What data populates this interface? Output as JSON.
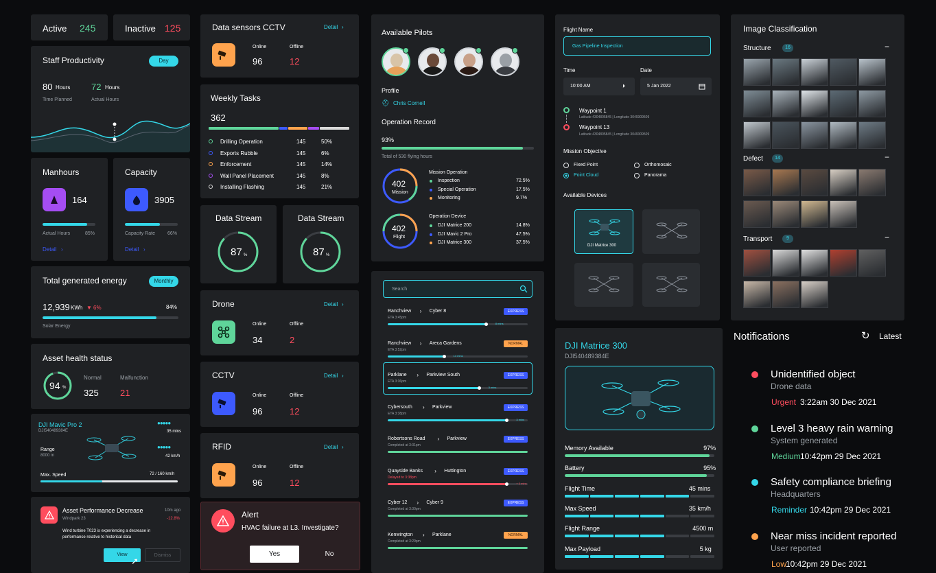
{
  "active": {
    "label": "Active",
    "value": "245"
  },
  "inactive": {
    "label": "Inactive",
    "value": "125"
  },
  "productivity": {
    "title": "Staff Productivity",
    "pill": "Day",
    "planned_value": "80",
    "planned_unit": "Hours",
    "planned_label": "Time Planned",
    "actual_value": "72",
    "actual_unit": "Hours",
    "actual_label": "Actual Hours"
  },
  "manhours": {
    "title": "Manhours",
    "value": "164",
    "bar_label": "Actual Hours",
    "pct": "85%",
    "fill": 0.85,
    "detail": "Detail"
  },
  "capacity": {
    "title": "Capacity",
    "value": "3905",
    "bar_label": "Capacity Rate",
    "pct": "66%",
    "fill": 0.66,
    "detail": "Detail"
  },
  "energy": {
    "title": "Total generated energy",
    "pill": "Monthly",
    "value": "12,939",
    "unit": "KWh",
    "change": "6%",
    "pct": "84%",
    "fill": 0.84,
    "label": "Solar Energy"
  },
  "asset_health": {
    "title": "Asset health status",
    "percent": "94",
    "percent_sign": "%",
    "normal_label": "Normal",
    "normal_value": "325",
    "malfunction_label": "Malfunction",
    "malfunction_value": "21",
    "fill": 0.94
  },
  "mavic": {
    "name": "DJI Mavic Pro 2",
    "id": "DJI540489384E",
    "time": "35 mins",
    "range_label": "Range",
    "range_value": "8000 m",
    "speed": "42 km/h",
    "max_speed_label": "Max. Speed",
    "max_speed_value": "72 / 160 km/h",
    "fill": 0.45
  },
  "asset_alert": {
    "title": "Asset Performance Decrease",
    "time": "10m ago",
    "location": "Windpark 23",
    "change": "-12.8%",
    "body1": "Wind turbine T023 is experiencing a decrease in",
    "body2": "performance relative to historical data",
    "view": "View",
    "dismiss": "Dismiss"
  },
  "cctv_sensors": {
    "title": "Data sensors CCTV",
    "detail": "Detail",
    "online_label": "Online",
    "online": "96",
    "offline_label": "Offline",
    "offline": "12"
  },
  "weekly": {
    "title": "Weekly Tasks",
    "total": "362",
    "items": [
      {
        "name": "Drilling Operation",
        "count": "145",
        "pct": "50%",
        "color": "#5fd59a"
      },
      {
        "name": "Exports Rubble",
        "count": "145",
        "pct": "6%",
        "color": "#3d5afe"
      },
      {
        "name": "Enforcement",
        "count": "145",
        "pct": "14%",
        "color": "#ffa34d"
      },
      {
        "name": "Wall Panel Placement",
        "count": "145",
        "pct": "8%",
        "color": "#a54df2"
      },
      {
        "name": "Installing Flashing",
        "count": "145",
        "pct": "21%",
        "color": "#d9d9d9"
      }
    ]
  },
  "stream1": {
    "title": "Data Stream",
    "value": "87",
    "sign": "%",
    "fill": 0.87
  },
  "stream2": {
    "title": "Data Stream",
    "value": "87",
    "sign": "%",
    "fill": 0.87
  },
  "drone": {
    "title": "Drone",
    "detail": "Detail",
    "online_label": "Online",
    "online": "34",
    "offline_label": "Offline",
    "offline": "2"
  },
  "cctv": {
    "title": "CCTV",
    "detail": "Detail",
    "online_label": "Online",
    "online": "96",
    "offline_label": "Offline",
    "offline": "12"
  },
  "rfid": {
    "title": "RFID",
    "detail": "Detail",
    "online_label": "Online",
    "online": "96",
    "offline_label": "Offline",
    "offline": "12"
  },
  "alert": {
    "title": "Alert",
    "message": "HVAC failure at L3. Investigate?",
    "yes": "Yes",
    "no": "No"
  },
  "pilots": {
    "title": "Available Pilots",
    "profile_label": "Profile",
    "profile_name": "Chris Cornell",
    "record_label": "Operation Record",
    "record_pct": "93%",
    "record_fill": 0.93,
    "record_sub": "Total of 530 flying hours",
    "ring1_value": "402",
    "ring1_label": "Mission",
    "ring2_value": "402",
    "ring2_label": "Flight",
    "mission_title": "Mission Operation",
    "missions": [
      {
        "name": "Inspection",
        "pct": "72.5%",
        "color": "#5fd59a"
      },
      {
        "name": "Special Operation",
        "pct": "17.5%",
        "color": "#3d5afe"
      },
      {
        "name": "Monitoring",
        "pct": "9.7%",
        "color": "#ffa34d"
      }
    ],
    "device_title": "Operation Device",
    "devices": [
      {
        "name": "DJI Matrice 200",
        "pct": "14.8%",
        "color": "#5fd59a"
      },
      {
        "name": "DJI Mavic 2 Pro",
        "pct": "47.5%",
        "color": "#3d5afe"
      },
      {
        "name": "DJI Matrice 300",
        "pct": "37.5%",
        "color": "#ffa34d"
      }
    ]
  },
  "routes": {
    "search_placeholder": "Search",
    "items": [
      {
        "from": "Ranchview",
        "to": "Cyber 8",
        "eta": "ETA 3:45pm",
        "tag": "EXPRESS",
        "prog": "8 mins",
        "fill": 0.7,
        "tagc": "#3d5afe",
        "barc": "#34d7e8"
      },
      {
        "from": "Ranchview",
        "to": "Areca Gardens",
        "eta": "ETA 3:52pm",
        "tag": "NORMAL",
        "prog": "14 mins",
        "fill": 0.4,
        "tagc": "#ffa34d",
        "barc": "#34d7e8"
      },
      {
        "from": "Parklane",
        "to": "Parkview South",
        "eta": "ETA 3:36pm",
        "tag": "EXPRESS",
        "prog": "3 mins",
        "fill": 0.65,
        "tagc": "#3d5afe",
        "barc": "#34d7e8"
      },
      {
        "from": "Cybersouth",
        "to": "Parkview",
        "eta": "ETA 3:38pm",
        "tag": "EXPRESS",
        "prog": "3 mins",
        "fill": 0.85,
        "tagc": "#3d5afe",
        "barc": "#34d7e8"
      },
      {
        "from": "Robertsons Road",
        "to": "Parkview",
        "eta": "Completed at 3:31pm",
        "tag": "EXPRESS",
        "prog": "",
        "fill": 1,
        "tagc": "#3d5afe",
        "barc": "#5fd59a"
      },
      {
        "from": "Quayside Banks",
        "to": "Huttington",
        "eta": "Delayed to 3:38pm",
        "tag": "EXPRESS",
        "prog": "+ 3 mins",
        "fill": 0.85,
        "tagc": "#3d5afe",
        "barc": "#ff4d5e"
      },
      {
        "from": "Cyber 12",
        "to": "Cyber 9",
        "eta": "Completed at 3:30pm",
        "tag": "EXPRESS",
        "prog": "",
        "fill": 1,
        "tagc": "#3d5afe",
        "barc": "#5fd59a"
      },
      {
        "from": "Kenwington",
        "to": "Parklane",
        "eta": "Completed at 3:29pm",
        "tag": "NORMAL",
        "prog": "",
        "fill": 1,
        "tagc": "#ffa34d",
        "barc": "#5fd59a"
      }
    ]
  },
  "flight": {
    "name_label": "Flight Name",
    "name_value": "Gas Pipeline Inspection",
    "time_label": "Time",
    "time_value": "10:00 AM",
    "date_label": "Date",
    "date_value": "5 Jan 2022",
    "wp1": "Waypoint 1",
    "wp1_coords": "Latitude 4304805845   |   Longitude 3049309509",
    "wp2": "Waypoint 13",
    "wp2_coords": "Latitude 4304805845   |   Longitude 3049309509",
    "objective_label": "Mission Objective",
    "obj1": "Fixed Point",
    "obj2": "Orthomosaic",
    "obj3": "Point Cloud",
    "obj4": "Panorama",
    "devices_label": "Available Devices",
    "device_selected": "DJI Matrice 300"
  },
  "matrice": {
    "name": "DJI Matrice 300",
    "id": "DJI540489384E",
    "stats": [
      {
        "label": "Memory Available",
        "value": "97%",
        "fill": 0.97,
        "seg": false
      },
      {
        "label": "Battery",
        "value": "95%",
        "fill": 0.95,
        "seg": false
      },
      {
        "label": "Flight Time",
        "value": "45 mins",
        "fill": 0.8,
        "seg": true
      },
      {
        "label": "Max Speed",
        "value": "35 km/h",
        "fill": 0.6,
        "seg": true
      },
      {
        "label": "Flight Range",
        "value": "4500 m",
        "fill": 0.6,
        "seg": true
      },
      {
        "label": "Max Payload",
        "value": "5 kg",
        "fill": 0.7,
        "seg": true
      }
    ]
  },
  "classification": {
    "title": "Image Classification",
    "structure_label": "Structure",
    "structure_count": "16",
    "defect_label": "Defect",
    "defect_count": "14",
    "transport_label": "Transport",
    "transport_count": "9"
  },
  "notifications": {
    "title": "Notifications",
    "latest": "Latest",
    "items": [
      {
        "title": "Unidentified object",
        "source": "Drone data",
        "level": "Urgent",
        "time": "3:22am 30 Dec 2021",
        "color": "#ff4d5e"
      },
      {
        "title": "Level 3 heavy rain warning",
        "source": "System generated",
        "level": "Medium",
        "time": "10:42pm 29 Dec 2021",
        "color": "#5fd59a"
      },
      {
        "title": "Safety compliance briefing",
        "source": "Headquarters",
        "level": "Reminder",
        "time": "10:42pm 29 Dec 2021",
        "color": "#34d7e8"
      },
      {
        "title": "Near miss incident reported",
        "source": "User reported",
        "level": "Low",
        "time": "10:42pm 29 Dec 2021",
        "color": "#ffa34d"
      }
    ]
  }
}
